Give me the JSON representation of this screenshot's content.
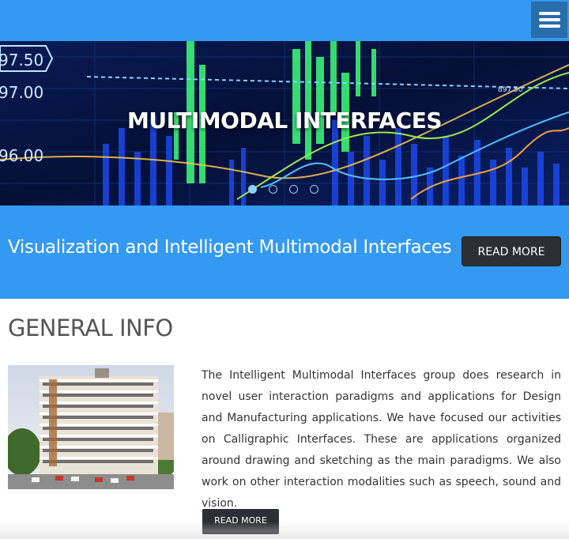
{
  "header": {
    "menu_icon": "hamburger-menu-icon",
    "bar_color": "#3399f3"
  },
  "hero": {
    "title": "MULTIMODAL INTERFACES",
    "price_labels": [
      "97.50",
      "97.00",
      "96.00",
      "897.50"
    ],
    "slides": 4,
    "active_slide": 1
  },
  "banner": {
    "heading": "Visualization and Intelligent Multimodal Interfaces",
    "button_label": "READ MORE"
  },
  "general_info": {
    "title": "GENERAL INFO",
    "image_alt": "building-photo",
    "text": "The Intelligent Multimodal Interfaces group does research in novel user interaction paradigms and applications for Design and Manufacturing applications. We have focused our activities on Calligraphic Interfaces. These are applications organized around drawing and sketching as the main paradigms. We also work on other interaction modalities such as speech, sound and vision.",
    "button_label": "READ MORE"
  },
  "colors": {
    "accent": "#3399f3",
    "dark_button": "#2c2f33",
    "menu_button": "#286eaa"
  }
}
